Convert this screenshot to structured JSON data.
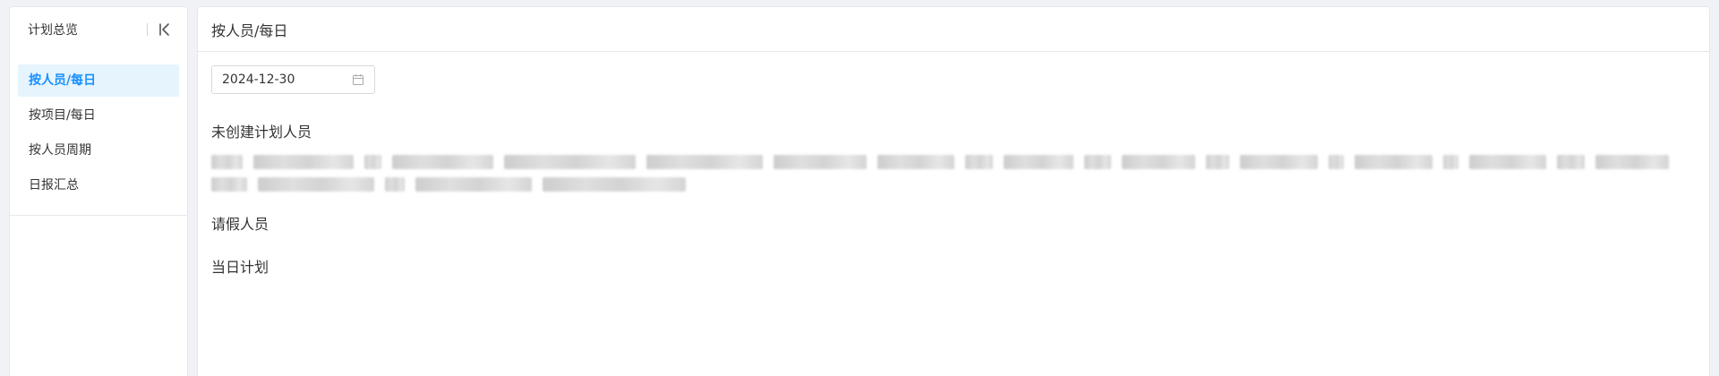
{
  "sidebar": {
    "title": "计划总览",
    "items": [
      {
        "label": "按人员/每日",
        "active": true
      },
      {
        "label": "按项目/每日",
        "active": false
      },
      {
        "label": "按人员周期",
        "active": false
      },
      {
        "label": "日报汇总",
        "active": false
      }
    ]
  },
  "main": {
    "title": "按人员/每日",
    "date_value": "2024-12-30",
    "sections": {
      "uncreated": "未创建计划人员",
      "leave": "请假人员",
      "today": "当日计划"
    }
  },
  "colors": {
    "accent": "#1890ff",
    "active_bg": "#e6f4fd",
    "border": "#e6e8eb",
    "page_bg": "#f0f2f5"
  },
  "icons": {
    "collapse": "collapse-left-icon",
    "calendar": "calendar-icon"
  }
}
